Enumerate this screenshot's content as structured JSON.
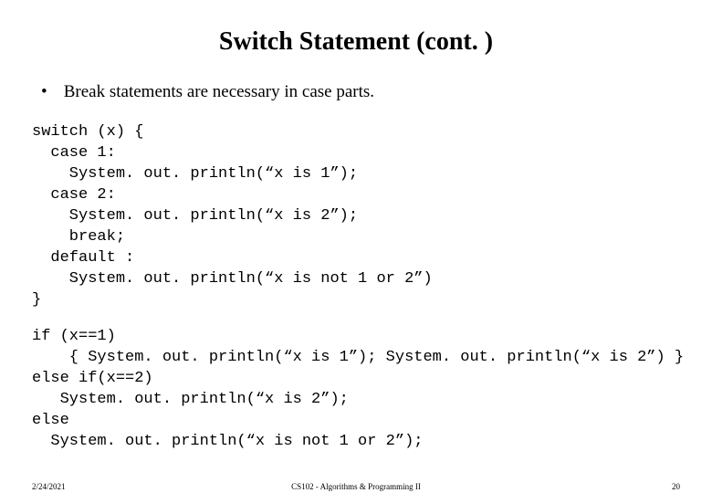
{
  "title": "Switch Statement (cont. )",
  "bullet": "Break statements are necessary in case parts.",
  "code1": "switch (x) {\n  case 1:\n    System. out. println(“x is 1”);\n  case 2:\n    System. out. println(“x is 2”);\n    break;\n  default :\n    System. out. println(“x is not 1 or 2”)\n}",
  "code2": "if (x==1)\n    { System. out. println(“x is 1”); System. out. println(“x is 2”) }\nelse if(x==2)\n   System. out. println(“x is 2”);\nelse\n  System. out. println(“x is not 1 or 2”);",
  "footer": {
    "date": "2/24/2021",
    "course": "CS102 - Algorithms & Programming II",
    "page": "20"
  }
}
